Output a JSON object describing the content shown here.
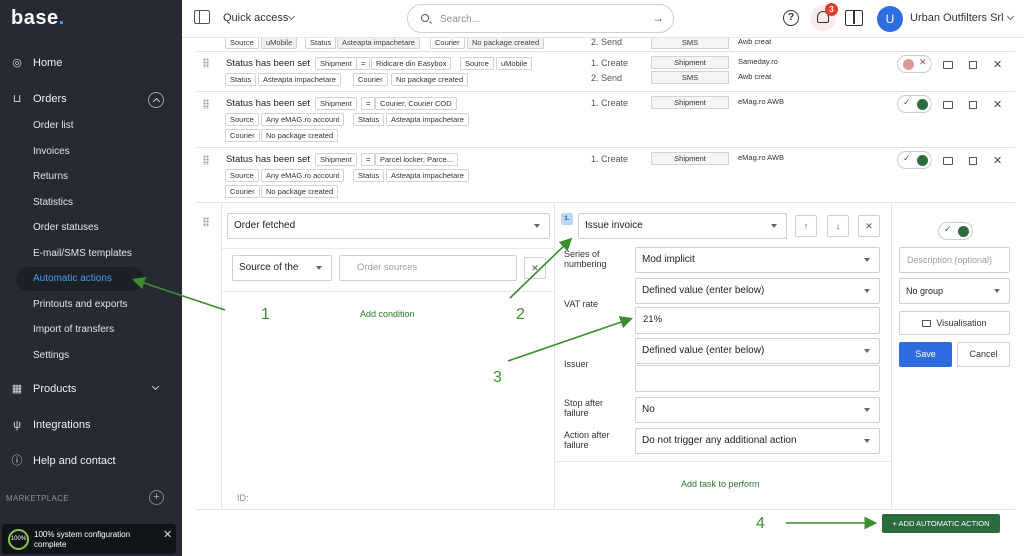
{
  "app": {
    "logo": "base",
    "logo_dot": "."
  },
  "sidebar": {
    "home": "Home",
    "orders": "Orders",
    "orders_sub": [
      "Order list",
      "Invoices",
      "Returns",
      "Statistics",
      "Order statuses",
      "E-mail/SMS templates",
      "Automatic actions",
      "Printouts and exports",
      "Import of transfers",
      "Settings"
    ],
    "products": "Products",
    "integrations": "Integrations",
    "help": "Help and contact",
    "marketplace": "MARKETPLACE",
    "toast_pct": "100%",
    "toast_text": "100% system configuration complete"
  },
  "header": {
    "quick_access": "Quick access",
    "search_placeholder": "Search...",
    "notifications_count": "3",
    "avatar_letter": "U",
    "user_name": "Urban Outfilters Srl"
  },
  "rows": [
    {
      "tags": [
        {
          "text": "Source",
          "gray": false
        },
        {
          "text": "uMobile",
          "gray": true
        },
        {
          "text": "Status",
          "gray": false
        },
        {
          "text": "Asteapta impachetare",
          "gray": true
        },
        {
          "text": "Courier",
          "gray": false
        },
        {
          "text": "No package created",
          "gray": true
        }
      ],
      "steps": [
        "2. Send"
      ],
      "pills": [
        {
          "box": "SMS",
          "val": "Awb creat"
        }
      ]
    },
    {
      "status_label": "Status has been set",
      "tags_line1": [
        {
          "text": "Shipment"
        },
        {
          "text": "="
        },
        {
          "text": "Ridicare din Easybox"
        },
        {
          "text": "Source"
        },
        {
          "text": "uMobile"
        }
      ],
      "tags_line2": [
        {
          "text": "Status"
        },
        {
          "text": "Asteapta impachetare"
        },
        {
          "text": "Courier"
        },
        {
          "text": "No package created"
        }
      ],
      "steps": [
        "1. Create",
        "2. Send"
      ],
      "pills": [
        {
          "box": "Shipment",
          "val": "Sameday.ro"
        },
        {
          "box": "SMS",
          "val": "Awb creat"
        }
      ]
    },
    {
      "status_label": "Status has been set",
      "tags_line1": [
        {
          "text": "Shipment"
        },
        {
          "text": "="
        },
        {
          "text": "Courier, Courier COD"
        }
      ],
      "tags_line2": [
        {
          "text": "Source"
        },
        {
          "text": "Any eMAG.ro account"
        },
        {
          "text": "Status"
        },
        {
          "text": "Asteapta impachetare"
        }
      ],
      "tags_line3": [
        {
          "text": "Courier"
        },
        {
          "text": "No package created"
        }
      ],
      "steps": [
        "1. Create"
      ],
      "pills": [
        {
          "box": "Shipment",
          "val": "eMag.ro AWB"
        }
      ]
    },
    {
      "status_label": "Status has been set",
      "tags_line1": [
        {
          "text": "Shipment"
        },
        {
          "text": "="
        },
        {
          "text": "Parcel locker, Parce..."
        }
      ],
      "tags_line2": [
        {
          "text": "Source"
        },
        {
          "text": "Any eMAG.ro account"
        },
        {
          "text": "Status"
        },
        {
          "text": "Asteapta impachetare"
        }
      ],
      "tags_line3": [
        {
          "text": "Courier"
        },
        {
          "text": "No package created"
        }
      ],
      "steps": [
        "1. Create"
      ],
      "pills": [
        {
          "box": "Shipment",
          "val": "eMag.ro AWB"
        }
      ]
    }
  ],
  "editor": {
    "trigger": "Order fetched",
    "condition_field": "Source of the",
    "condition_value_placeholder": "Order sources",
    "add_condition": "Add condition",
    "id_label": "ID:",
    "task_index": "1.",
    "task": "Issue invoice",
    "series_label": "Series of numbering",
    "series_value": "Mod implicit",
    "vat_label": "VAT rate",
    "vat_mode": "Defined value (enter below)",
    "vat_value": "21%",
    "issuer_label": "Issuer",
    "issuer_mode": "Defined value (enter below)",
    "issuer_value": "",
    "stop_label": "Stop after failure",
    "stop_value": "No",
    "after_label": "Action after failure",
    "after_value": "Do not trigger any additional action",
    "add_task": "Add task to perform",
    "description_placeholder": "Description (optional)",
    "group_value": "No group",
    "visualisation": "Visualisation",
    "save": "Save",
    "cancel": "Cancel",
    "add_automatic_action": "ADD AUTOMATIC ACTION"
  },
  "annotations": [
    "1",
    "2",
    "3",
    "4"
  ],
  "colors": {
    "sidebar_bg": "#262b33",
    "accent_blue": "#2e6de0",
    "primary_green": "#2c6b3e",
    "annotation_green": "#3d8c2f",
    "badge_red": "#e03c31"
  }
}
